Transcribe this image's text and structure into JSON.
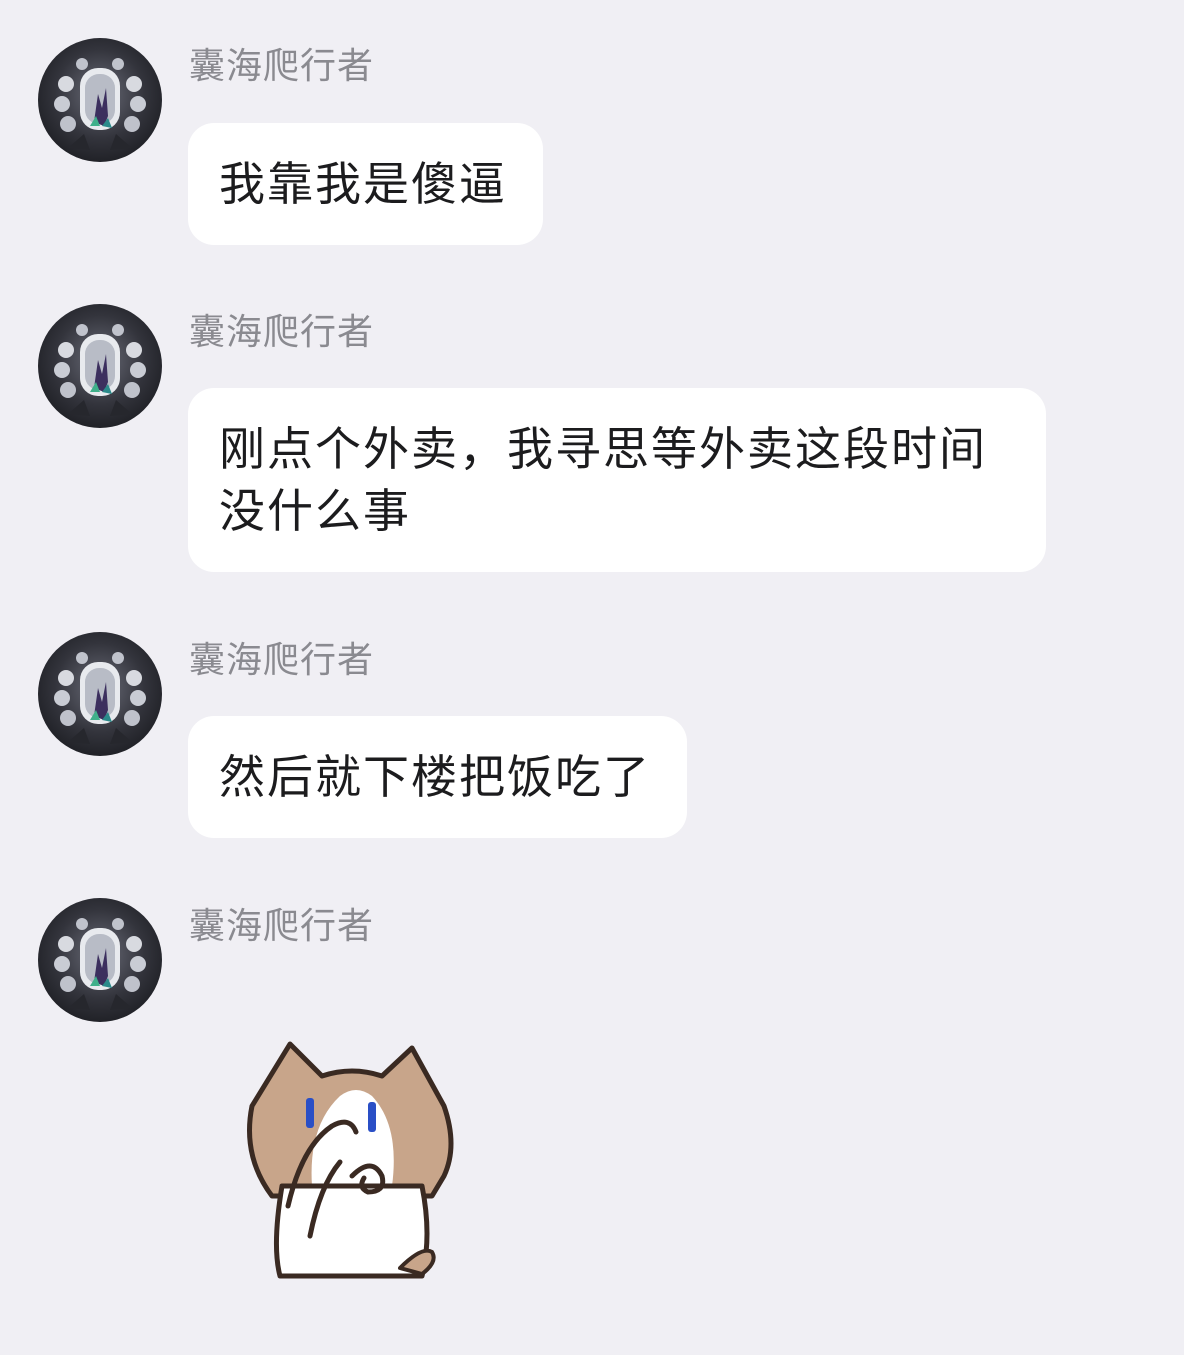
{
  "colors": {
    "background": "#f0eff4",
    "bubble": "#ffffff",
    "sender_name": "#8a8a90",
    "message_text": "#1c1c1e"
  },
  "messages": [
    {
      "sender": "囊海爬行者",
      "text": "我靠我是傻逼"
    },
    {
      "sender": "囊海爬行者",
      "text": "刚点个外卖，我寻思等外卖这段时间没什么事"
    },
    {
      "sender": "囊海爬行者",
      "text": "然后就下楼把饭吃了"
    },
    {
      "sender": "囊海爬行者",
      "sticker": "cat-facepalm-sticker"
    }
  ]
}
